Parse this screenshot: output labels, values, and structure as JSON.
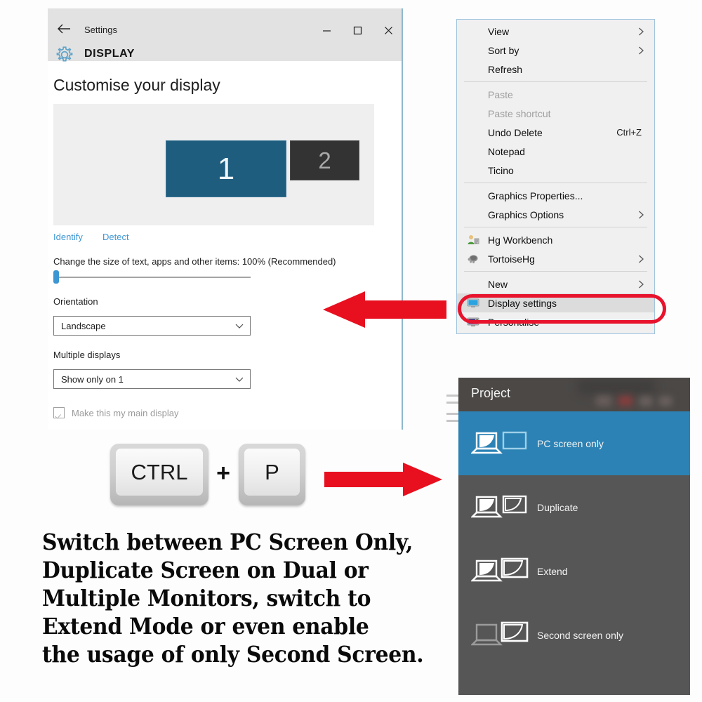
{
  "settings_window": {
    "back_icon": "back-arrow-icon",
    "title": "Settings",
    "window_controls": {
      "minimize": "minimize-icon",
      "maximize": "maximize-icon",
      "close": "close-icon"
    },
    "gear_icon": "gear-icon",
    "section_title": "DISPLAY",
    "page_heading": "Customise your display",
    "monitors": [
      {
        "number": "1",
        "state": "selected",
        "color": "#1f5d7f"
      },
      {
        "number": "2",
        "state": "inactive",
        "color": "#333333"
      }
    ],
    "identify_link": "Identify",
    "detect_link": "Detect",
    "scale_label": "Change the size of text, apps and other items: 100% (Recommended)",
    "scale_value": "100%",
    "orientation": {
      "label": "Orientation",
      "value": "Landscape",
      "chevron": "chevron-down-icon"
    },
    "multiple_displays": {
      "label": "Multiple displays",
      "value": "Show only on 1",
      "chevron": "chevron-down-icon"
    },
    "main_display_checkbox": {
      "label": "Make this my main display",
      "checked": true,
      "disabled": true
    }
  },
  "context_menu": {
    "items": [
      {
        "label": "View",
        "submenu": true,
        "disabled": false,
        "icon": null,
        "accel": ""
      },
      {
        "label": "Sort by",
        "submenu": true,
        "disabled": false,
        "icon": null,
        "accel": ""
      },
      {
        "label": "Refresh",
        "submenu": false,
        "disabled": false,
        "icon": null,
        "accel": ""
      },
      {
        "separator": true
      },
      {
        "label": "Paste",
        "submenu": false,
        "disabled": true,
        "icon": null,
        "accel": ""
      },
      {
        "label": "Paste shortcut",
        "submenu": false,
        "disabled": true,
        "icon": null,
        "accel": ""
      },
      {
        "label": "Undo Delete",
        "submenu": false,
        "disabled": false,
        "icon": null,
        "accel": "Ctrl+Z"
      },
      {
        "label": "Notepad",
        "submenu": false,
        "disabled": false,
        "icon": null,
        "accel": ""
      },
      {
        "label": "Ticino",
        "submenu": false,
        "disabled": false,
        "icon": null,
        "accel": ""
      },
      {
        "separator": true
      },
      {
        "label": "Graphics Properties...",
        "submenu": false,
        "disabled": false,
        "icon": null,
        "accel": ""
      },
      {
        "label": "Graphics Options",
        "submenu": true,
        "disabled": false,
        "icon": null,
        "accel": ""
      },
      {
        "separator": true
      },
      {
        "label": "Hg Workbench",
        "submenu": false,
        "disabled": false,
        "icon": "hg-workbench-icon",
        "accel": ""
      },
      {
        "label": "TortoiseHg",
        "submenu": true,
        "disabled": false,
        "icon": "tortoisehg-icon",
        "accel": ""
      },
      {
        "separator": true
      },
      {
        "label": "New",
        "submenu": true,
        "disabled": false,
        "icon": null,
        "accel": ""
      },
      {
        "label": "Display settings",
        "submenu": false,
        "disabled": false,
        "icon": "display-settings-icon",
        "accel": "",
        "highlighted": true
      },
      {
        "label": "Personalise",
        "submenu": false,
        "disabled": false,
        "icon": "personalise-icon",
        "accel": ""
      }
    ],
    "highlight_color": "#e8132c"
  },
  "shortcut": {
    "key1": "CTRL",
    "separator": "+",
    "key2": "P"
  },
  "arrows": {
    "left_arrow": "arrow-left-icon",
    "right_arrow": "arrow-right-icon",
    "color": "#e8101f"
  },
  "caption": {
    "lines": [
      "Switch between PC Screen Only,",
      "Duplicate Screen on Dual or",
      "Multiple Monitors, switch to",
      "Extend Mode or even enable",
      "the usage of only Second Screen."
    ]
  },
  "project_panel": {
    "title": "Project",
    "accent_color": "#2c82b5",
    "options": [
      {
        "label": "PC screen only",
        "icon": "pc-screen-only-icon",
        "selected": true
      },
      {
        "label": "Duplicate",
        "icon": "duplicate-icon",
        "selected": false
      },
      {
        "label": "Extend",
        "icon": "extend-icon",
        "selected": false
      },
      {
        "label": "Second screen only",
        "icon": "second-screen-only-icon",
        "selected": false
      }
    ]
  }
}
